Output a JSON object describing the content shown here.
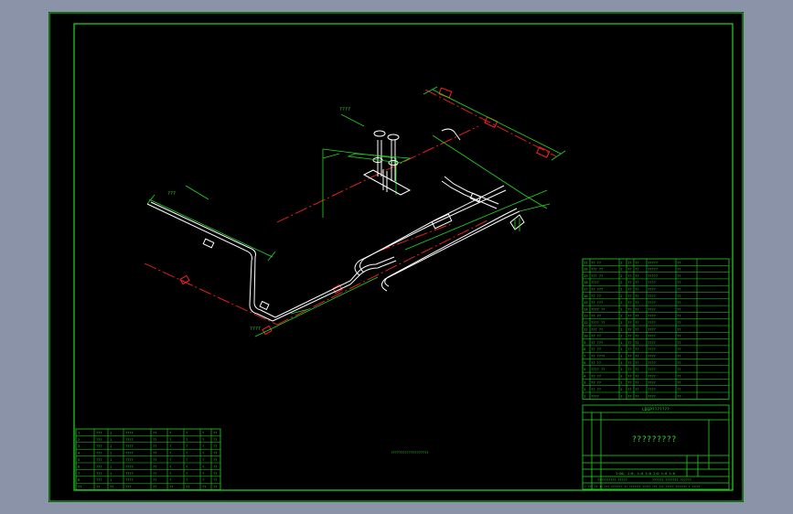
{
  "colors": {
    "background": "#8a93a8",
    "paper": "#000000",
    "border": "#22d822",
    "pipe": "#ffffff",
    "centerline": "#ff2020",
    "dimension": "#22d822",
    "label": "#22d822"
  },
  "drawing": {
    "sheet_title": "?????????",
    "drawing_number_label": "LDGP???????",
    "bottom_center_note": "???????????????????",
    "scale_row": "1:00, 1:0, 1:0 1:0 1:0 1:0 1:0",
    "footer_left": "?????????? ?????",
    "footer_right": "?????? ??????? ??????",
    "footer_note": "? ??? ?? ?? ??? ??????? ?? ??????? ????? ??? ??? ????? ??????? ? ?????",
    "material_rows": [
      {
        "no": "21",
        "name": "?? ??",
        "qty": "2",
        "code": "17",
        "mat": "??",
        "size": "?????",
        "wt": "??"
      },
      {
        "no": "20",
        "name": "??? ??",
        "qty": "2",
        "code": "??",
        "mat": "??",
        "size": "?????",
        "wt": "??"
      },
      {
        "no": "19",
        "name": "??? ??",
        "qty": "2",
        "code": "??",
        "mat": "??",
        "size": "?????",
        "wt": "??"
      },
      {
        "no": "18",
        "name": "????",
        "qty": "2",
        "code": "??",
        "mat": "??",
        "size": "????",
        "wt": "??"
      },
      {
        "no": "17",
        "name": "?? ???",
        "qty": "2",
        "code": "??",
        "mat": "??",
        "size": "????",
        "wt": "??"
      },
      {
        "no": "16",
        "name": "?? ??",
        "qty": "2",
        "code": "??",
        "mat": "??",
        "size": "????",
        "wt": "??"
      },
      {
        "no": "15",
        "name": "?? ???",
        "qty": "2",
        "code": "??",
        "mat": "??",
        "size": "????",
        "wt": "??"
      },
      {
        "no": "14",
        "name": "???? ??",
        "qty": "2",
        "code": "??",
        "mat": "??",
        "size": "????",
        "wt": "??"
      },
      {
        "no": "13",
        "name": "?? ??",
        "qty": "2",
        "code": "??",
        "mat": "??",
        "size": "????",
        "wt": "??"
      },
      {
        "no": "12",
        "name": "???? ??",
        "qty": "2",
        "code": "??",
        "mat": "??",
        "size": "????",
        "wt": "??"
      },
      {
        "no": "11",
        "name": "??? ??",
        "qty": "2",
        "code": "??",
        "mat": "??",
        "size": "????",
        "wt": "??"
      },
      {
        "no": "10",
        "name": "?? ??",
        "qty": "2",
        "code": "??",
        "mat": "??",
        "size": "????",
        "wt": "??"
      },
      {
        "no": "9",
        "name": "?? ???",
        "qty": "1",
        "code": "??",
        "mat": "??",
        "size": "????",
        "wt": "??"
      },
      {
        "no": "8",
        "name": "?? ??",
        "qty": "1",
        "code": "??",
        "mat": "??",
        "size": "????",
        "wt": "??"
      },
      {
        "no": "7",
        "name": "?? ????",
        "qty": "1",
        "code": "??",
        "mat": "??",
        "size": "????",
        "wt": "??"
      },
      {
        "no": "6",
        "name": "?? ??",
        "qty": "1",
        "code": "??",
        "mat": "??",
        "size": "????",
        "wt": "??"
      },
      {
        "no": "5",
        "name": "???? ??",
        "qty": "1",
        "code": "??",
        "mat": "??",
        "size": "????",
        "wt": "??"
      },
      {
        "no": "4",
        "name": "?? ??",
        "qty": "2",
        "code": "??",
        "mat": "??",
        "size": "????",
        "wt": "??"
      },
      {
        "no": "3",
        "name": "?? ??",
        "qty": "2",
        "code": "??",
        "mat": "??",
        "size": "????",
        "wt": "??"
      },
      {
        "no": "2",
        "name": "?? ??",
        "qty": "2",
        "code": "??",
        "mat": "??",
        "size": "????",
        "wt": "??"
      },
      {
        "no": "1",
        "name": "????",
        "qty": "2",
        "code": "??",
        "mat": "??",
        "size": "????",
        "wt": "??"
      }
    ],
    "legend_rows": [
      [
        "1",
        "???",
        "1",
        "????",
        "??",
        "?",
        "?",
        "?",
        "??"
      ],
      [
        "2",
        "???",
        "1",
        "????",
        "??",
        "?",
        "?",
        "?",
        "??"
      ],
      [
        "3",
        "???",
        "1",
        "????",
        "??",
        "?",
        "?",
        "?",
        "??"
      ],
      [
        "4",
        "???",
        "1",
        "????",
        "??",
        "?",
        "?",
        "?",
        "??"
      ],
      [
        "5",
        "???",
        "1",
        "????",
        "??",
        "?",
        "?",
        "?",
        "??"
      ],
      [
        "6",
        "???",
        "1",
        "????",
        "??",
        "?",
        "?",
        "?",
        "??"
      ],
      [
        "7",
        "???",
        "1",
        "????",
        "??",
        "?",
        "?",
        "?",
        "??"
      ],
      [
        "8",
        "???",
        "1",
        "????",
        "??",
        "?",
        "?",
        "?",
        "??"
      ],
      [
        "??",
        "??",
        "??",
        "???",
        "??",
        "??",
        "??",
        "??",
        "??"
      ]
    ],
    "pipe_labels": {
      "top_tag": "????",
      "left_tag": "???",
      "bottom_tag": "????"
    }
  }
}
